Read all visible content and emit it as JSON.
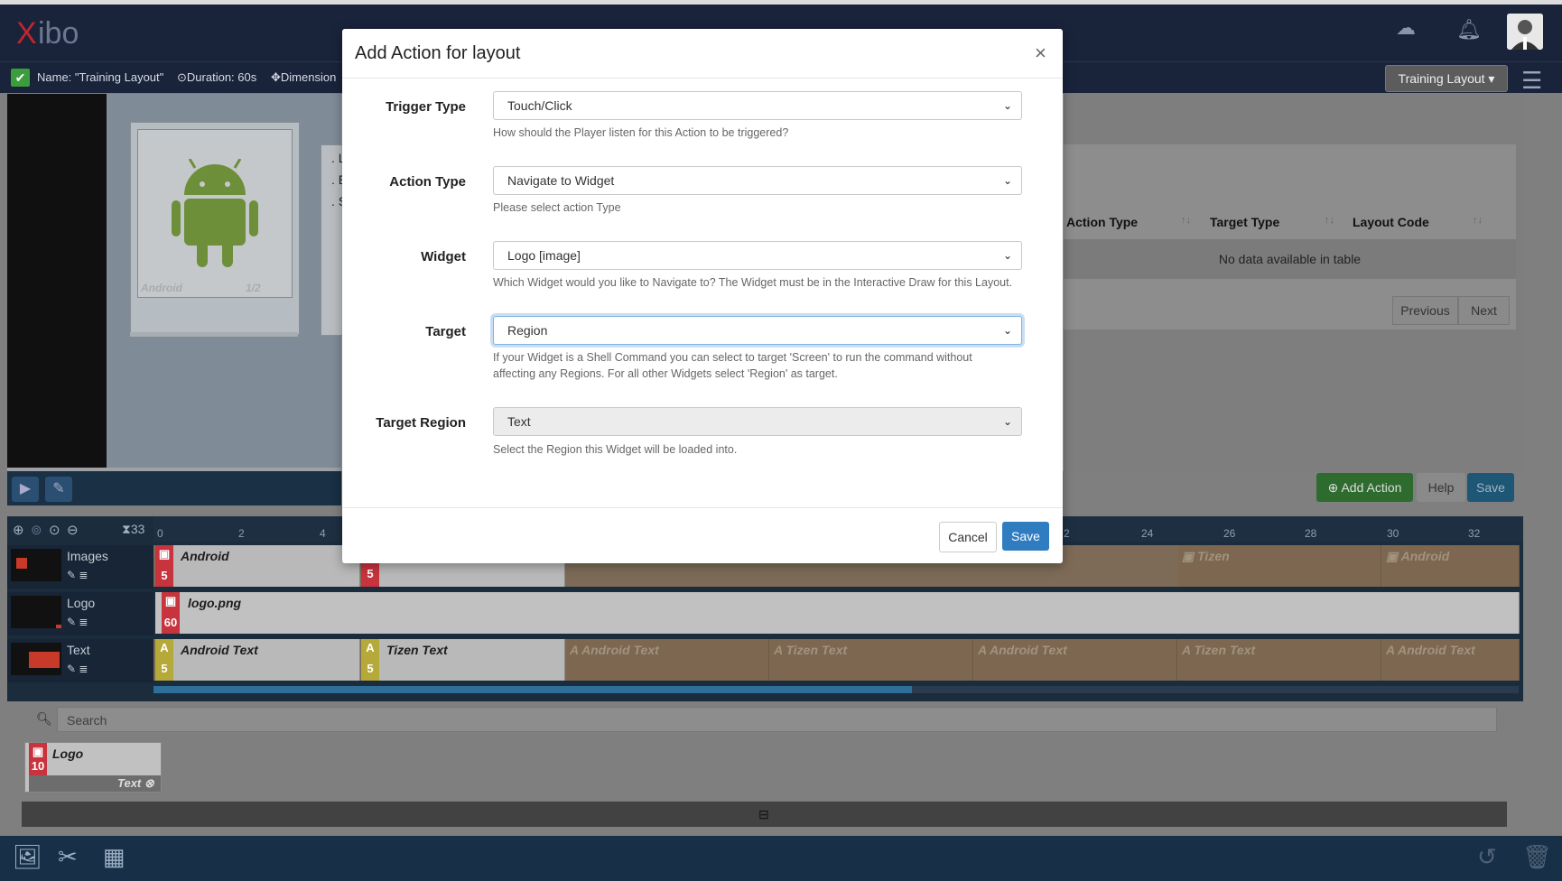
{
  "header": {
    "logo_text_x": "X",
    "logo_text_rest": "ibo",
    "cloud_icon": "cloud-icon",
    "bell_icon": "bell-icon"
  },
  "infobar": {
    "name": "Name: \"Training Layout\"",
    "duration": "Duration: 60s",
    "dimensions": "Dimension",
    "layout_dropdown": "Training Layout ▾"
  },
  "viewer": {
    "android_caption": "Android",
    "android_pager": "1/2",
    "text_lines": [
      ". L",
      ". E",
      ". S"
    ]
  },
  "actions_table": {
    "columns": [
      "Action Type",
      "Target Type",
      "Layout Code"
    ],
    "empty_message": "No data available in table",
    "previous": "Previous",
    "next": "Next",
    "add_action": "Add Action",
    "help": "Help",
    "save": "Save"
  },
  "timeline": {
    "zoom_level": "33",
    "ticks": [
      "0",
      "2",
      "4",
      "24",
      "26",
      "28",
      "30",
      "32",
      "2"
    ],
    "rows": [
      {
        "name": "Images",
        "items": [
          {
            "label": "Android",
            "duration": "5"
          },
          {
            "label": "",
            "duration": "5"
          },
          {
            "label": "Tizen"
          },
          {
            "label": "Android"
          }
        ]
      },
      {
        "name": "Logo",
        "items": [
          {
            "label": "logo.png",
            "duration": "60"
          }
        ]
      },
      {
        "name": "Text",
        "items": [
          {
            "label": "Android Text",
            "duration": "5"
          },
          {
            "label": "Tizen Text",
            "duration": "5"
          },
          {
            "label": "Android Text"
          },
          {
            "label": "Tizen Text"
          },
          {
            "label": "Android Text"
          },
          {
            "label": "Tizen Text"
          },
          {
            "label": "Android Text"
          }
        ]
      }
    ]
  },
  "library": {
    "search_placeholder": "Search",
    "item_name": "Logo",
    "item_duration": "10",
    "item_region": "Text"
  },
  "modal": {
    "title": "Add Action for layout",
    "close": "×",
    "fields": {
      "trigger_type": {
        "label": "Trigger Type",
        "value": "Touch/Click",
        "help": "How should the Player listen for this Action to be triggered?"
      },
      "action_type": {
        "label": "Action Type",
        "value": "Navigate to Widget",
        "help": "Please select action Type"
      },
      "widget": {
        "label": "Widget",
        "value": "Logo [image]",
        "help": "Which Widget would you like to Navigate to? The Widget must be in the Interactive Draw for this Layout."
      },
      "target": {
        "label": "Target",
        "value": "Region",
        "help_line1": "If your Widget is a Shell Command you can select to target 'Screen' to run the command without",
        "help_line2": "affecting any Regions. For all other Widgets select 'Region' as target."
      },
      "target_region": {
        "label": "Target Region",
        "value": "Text",
        "help": "Select the Region this Widget will be loaded into."
      }
    },
    "cancel": "Cancel",
    "save": "Save"
  },
  "colors": {
    "header_bg": "#19233a",
    "primary": "#2f7dc0",
    "success": "#3b9d3b",
    "image_badge": "#c7343d",
    "text_badge": "#b5a93a"
  }
}
